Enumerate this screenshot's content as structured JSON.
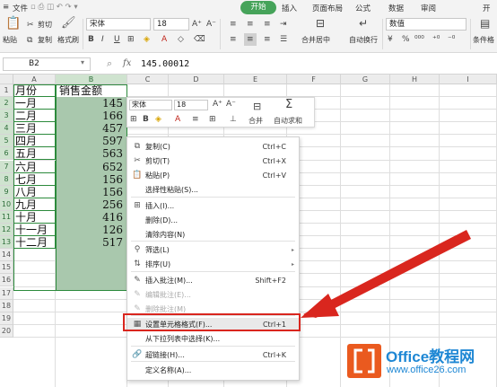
{
  "menu": {
    "file": "文件",
    "tabs": [
      "开始",
      "插入",
      "页面布局",
      "公式",
      "数据",
      "审阅",
      "开"
    ]
  },
  "ribbon": {
    "cut": "剪切",
    "paste": "粘贴",
    "copy": "复制",
    "format_painter": "格式刷",
    "font": "宋体",
    "size": "18",
    "merge_center": "合并居中",
    "wrap_text": "自动换行",
    "number_format": "数值",
    "cond_format": "条件格"
  },
  "formula_bar": {
    "cell_ref": "B2",
    "fx": "fx",
    "value": "145.00012"
  },
  "columns": [
    "A",
    "B",
    "C",
    "D",
    "E",
    "F",
    "G",
    "H",
    "I",
    "J"
  ],
  "rows": [
    "1",
    "2",
    "3",
    "4",
    "5",
    "6",
    "7",
    "8",
    "9",
    "10",
    "11",
    "12",
    "13",
    "14",
    "15",
    "16",
    "17",
    "18",
    "19",
    "20"
  ],
  "table": {
    "header_a": "月份",
    "header_b": "销售金额",
    "months": [
      "一月",
      "二月",
      "三月",
      "四月",
      "五月",
      "六月",
      "七月",
      "八月",
      "九月",
      "十月",
      "十一月",
      "十二月"
    ],
    "values": [
      "145",
      "166",
      "457",
      "597",
      "563",
      "652",
      "156",
      "156",
      "256",
      "416",
      "126",
      "517"
    ]
  },
  "mini_toolbar": {
    "font": "宋体",
    "size": "18",
    "merge": "合并",
    "autosum": "自动求和"
  },
  "context_menu": [
    {
      "label": "复制(C)",
      "shortcut": "Ctrl+C",
      "icon": "copy-icon",
      "glyph": "⧉"
    },
    {
      "label": "剪切(T)",
      "shortcut": "Ctrl+X",
      "icon": "scissors-icon",
      "glyph": "✂"
    },
    {
      "label": "粘贴(P)",
      "shortcut": "Ctrl+V",
      "icon": "paste-icon",
      "glyph": "📋"
    },
    {
      "label": "选择性粘贴(S)...",
      "shortcut": "",
      "icon": "",
      "glyph": ""
    },
    {
      "label": "插入(I)...",
      "shortcut": "",
      "icon": "insert-icon",
      "glyph": "⊞"
    },
    {
      "label": "删除(D)...",
      "shortcut": "",
      "icon": "",
      "glyph": ""
    },
    {
      "label": "清除内容(N)",
      "shortcut": "",
      "icon": "",
      "glyph": ""
    },
    {
      "label": "筛选(L)",
      "shortcut": "",
      "icon": "filter-icon",
      "glyph": "⚲",
      "submenu": true
    },
    {
      "label": "排序(U)",
      "shortcut": "",
      "icon": "sort-icon",
      "glyph": "⇅",
      "submenu": true
    },
    {
      "label": "插入批注(M)...",
      "shortcut": "Shift+F2",
      "icon": "comment-icon",
      "glyph": "✎"
    },
    {
      "label": "编辑批注(E)...",
      "shortcut": "",
      "icon": "edit-comment-icon",
      "glyph": "✎",
      "disabled": true
    },
    {
      "label": "删除批注(M)",
      "shortcut": "",
      "icon": "delete-comment-icon",
      "glyph": "✎",
      "disabled": true
    },
    {
      "label": "设置单元格格式(F)...",
      "shortcut": "Ctrl+1",
      "icon": "format-cells-icon",
      "glyph": "▦",
      "highlight": true
    },
    {
      "label": "从下拉列表中选择(K)...",
      "shortcut": "",
      "icon": "",
      "glyph": ""
    },
    {
      "label": "超链接(H)...",
      "shortcut": "Ctrl+K",
      "icon": "link-icon",
      "glyph": "🔗"
    },
    {
      "label": "定义名称(A)...",
      "shortcut": "",
      "icon": "",
      "glyph": ""
    }
  ],
  "logo": {
    "brand": "Office教程网",
    "url": "www.office26.com"
  },
  "colors": {
    "accent_green": "#46a35a",
    "selection_fill": "#a9c8ad",
    "highlight_red": "#d9261e",
    "logo_orange": "#ea5a1f",
    "logo_blue": "#1e87d4"
  }
}
